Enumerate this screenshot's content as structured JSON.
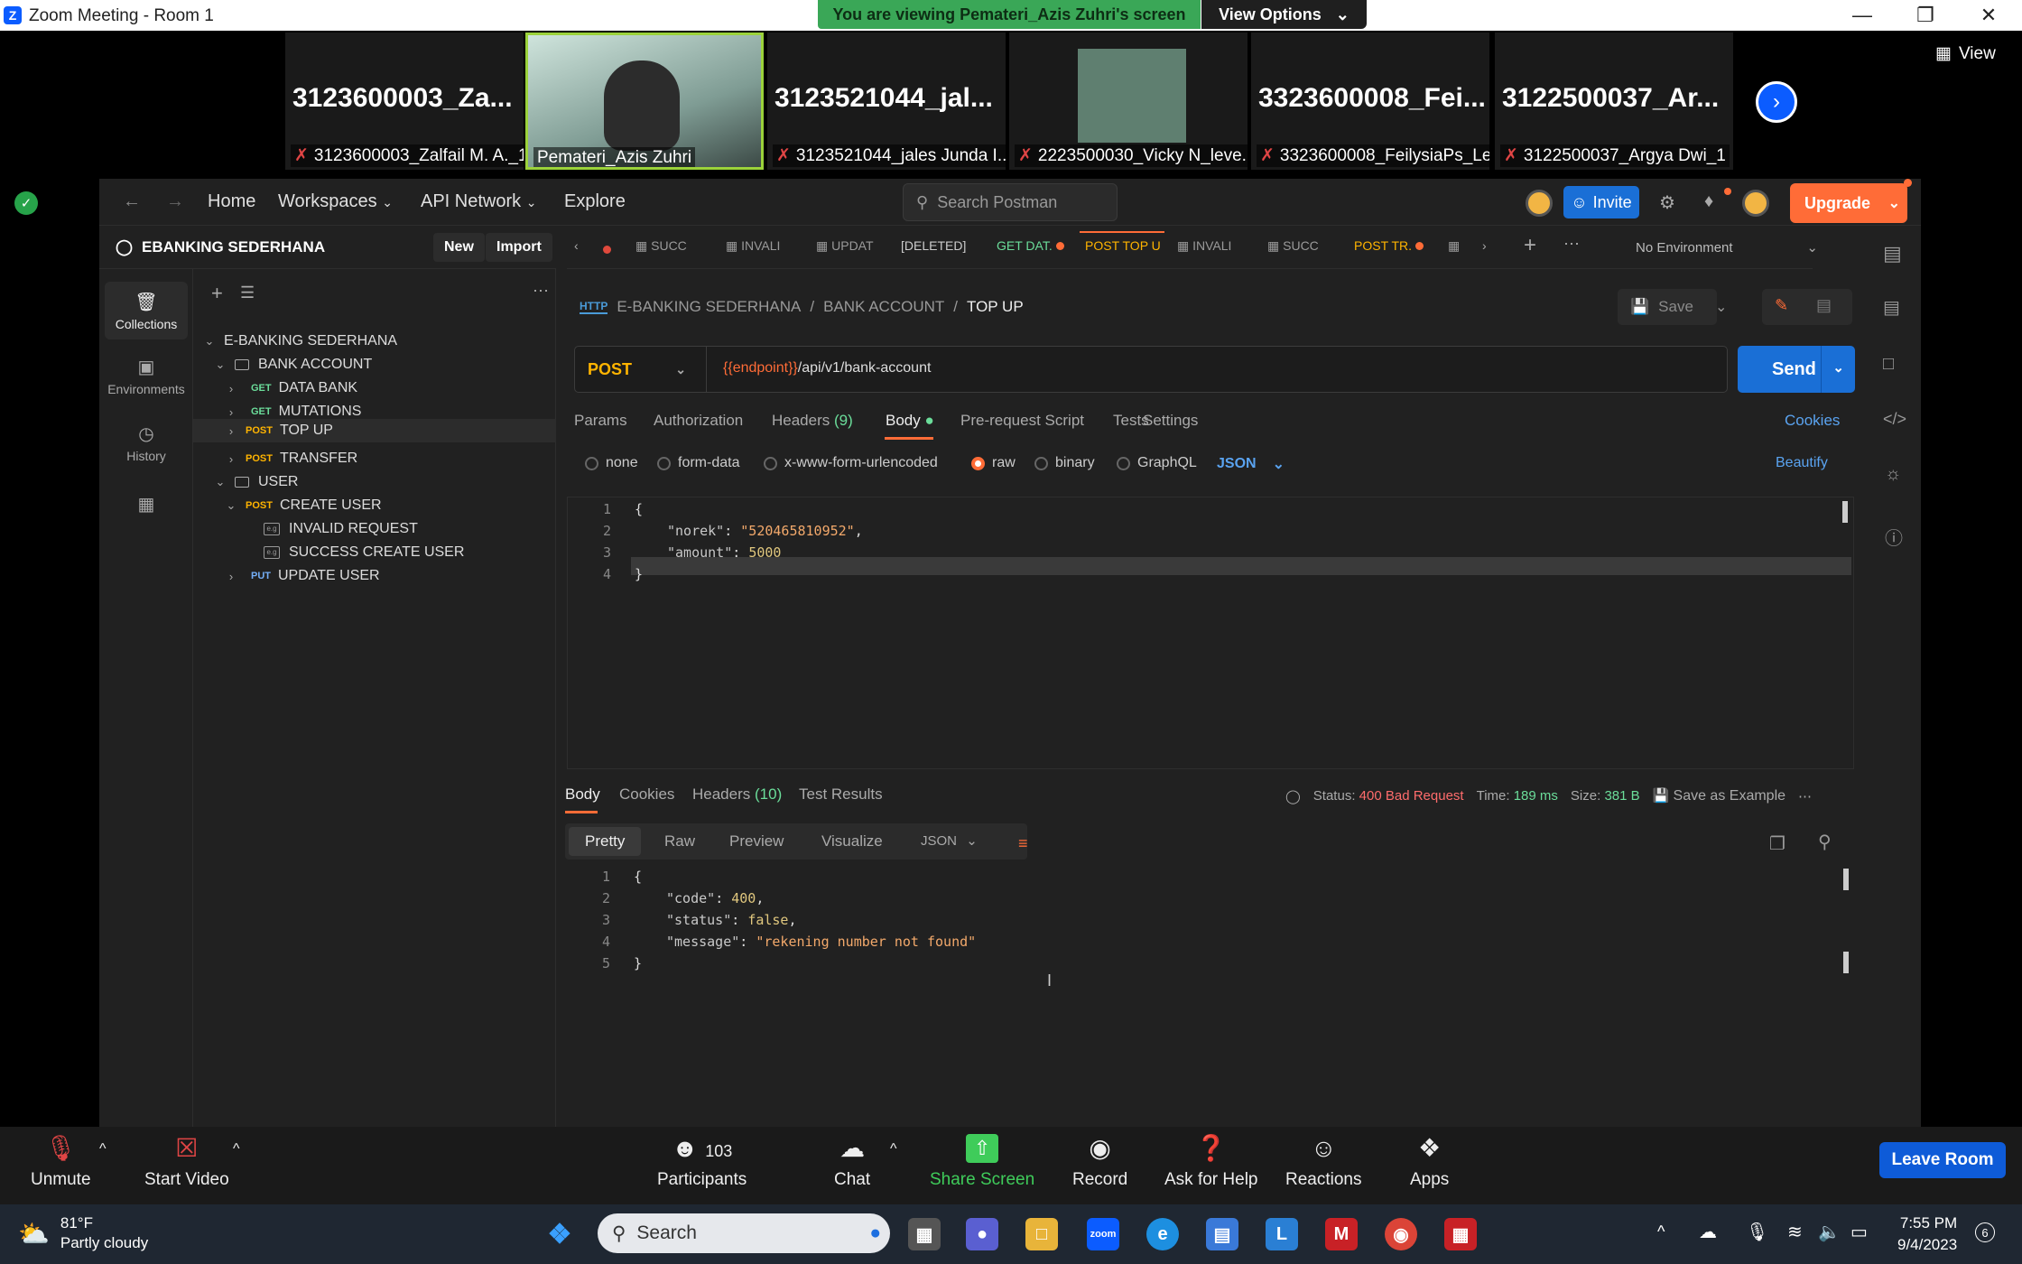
{
  "window": {
    "title": "Zoom Meeting - Room 1",
    "logo": "Z",
    "viewing_banner": "You are viewing Pemateri_Azis Zuhri's screen",
    "view_options": "View Options",
    "view_label": "View"
  },
  "gallery": [
    {
      "big": "3123600003_Za...",
      "name": "3123600003_Zalfail M. A._1"
    },
    {
      "big": "",
      "name": "Pemateri_Azis Zuhri"
    },
    {
      "big": "3123521044_jal...",
      "name": "3123521044_jales Junda I..."
    },
    {
      "big": "",
      "name": "2223500030_Vicky N_leve..."
    },
    {
      "big": "3323600008_Fei...",
      "name": "3323600008_FeilysiaPs_Le..."
    },
    {
      "big": "3122500037_Ar...",
      "name": "3122500037_Argya Dwi_1"
    }
  ],
  "postman": {
    "nav": {
      "home": "Home",
      "workspaces": "Workspaces",
      "api_network": "API Network",
      "explore": "Explore",
      "search": "Search Postman",
      "invite": "Invite",
      "upgrade": "Upgrade"
    },
    "workspace": {
      "name": "EBANKING SEDERHANA",
      "new": "New",
      "import": "Import"
    },
    "rail": [
      "Collections",
      "Environments",
      "History"
    ],
    "tree": {
      "root": "E-BANKING SEDERHANA",
      "folder1": "BANK ACCOUNT",
      "items1": [
        {
          "m": "GET",
          "label": "DATA BANK"
        },
        {
          "m": "GET",
          "label": "MUTATIONS"
        },
        {
          "m": "POST",
          "label": "TOP UP"
        },
        {
          "m": "POST",
          "label": "TRANSFER"
        }
      ],
      "folder2": "USER",
      "create": {
        "m": "POST",
        "label": "CREATE USER"
      },
      "examples": [
        "INVALID REQUEST",
        "SUCCESS CREATE USER"
      ],
      "update": {
        "m": "PUT",
        "label": "UPDATE USER"
      }
    },
    "tabs": [
      "SUCC",
      "INVALI",
      "UPDAT",
      "[DELETED]",
      "GET DAT.",
      "POST TOP U",
      "INVALI",
      "SUCC",
      "POST TR."
    ],
    "environment": "No Environment",
    "breadcrumb": {
      "a": "E-BANKING SEDERHANA",
      "b": "BANK ACCOUNT",
      "c": "TOP UP",
      "sep": "/"
    },
    "save": "Save",
    "request": {
      "method": "POST",
      "url_var": "{{endpoint}}",
      "url_path": "/api/v1/bank-account",
      "send": "Send"
    },
    "req_tabs": {
      "params": "Params",
      "auth": "Authorization",
      "headers": "Headers",
      "headers_count": "(9)",
      "body": "Body",
      "pre": "Pre-request Script",
      "tests": "Tests",
      "settings": "Settings",
      "cookies": "Cookies"
    },
    "body_types": [
      "none",
      "form-data",
      "x-www-form-urlencoded",
      "raw",
      "binary",
      "GraphQL"
    ],
    "body_format": "JSON",
    "beautify": "Beautify",
    "req_body": {
      "l1": "{",
      "k1": "\"norek\"",
      "v1": "\"520465810952\"",
      "k2": "\"amount\"",
      "v2": "5000",
      "l4": "}"
    },
    "resp_tabs": {
      "body": "Body",
      "cookies": "Cookies",
      "headers": "Headers",
      "headers_count": "(10)",
      "tests": "Test Results"
    },
    "status": {
      "label": "Status:",
      "code": "400 Bad Request",
      "time_label": "Time:",
      "time": "189 ms",
      "size_label": "Size:",
      "size": "381 B",
      "save_example": "Save as Example"
    },
    "view_tabs": [
      "Pretty",
      "Raw",
      "Preview",
      "Visualize"
    ],
    "resp_body": {
      "l1": "{",
      "k1": "\"code\"",
      "v1": "400",
      "k2": "\"status\"",
      "v2": "false",
      "k3": "\"message\"",
      "v3": "\"rekening number not found\"",
      "l5": "}"
    }
  },
  "zoom": {
    "unmute": "Unmute",
    "start_video": "Start Video",
    "participants": "Participants",
    "participants_count": "103",
    "chat": "Chat",
    "share": "Share Screen",
    "record": "Record",
    "help": "Ask for Help",
    "reactions": "Reactions",
    "apps": "Apps",
    "leave": "Leave Room"
  },
  "taskbar": {
    "temp": "81°F",
    "weather": "Partly cloudy",
    "search": "Search",
    "time": "7:55 PM",
    "date": "9/4/2023",
    "badge": "6"
  },
  "colors": {
    "accent": "#ff6c37",
    "send": "#1a6fd6",
    "zoom_blue": "#0b5cff",
    "green_banner": "#3aa757"
  }
}
